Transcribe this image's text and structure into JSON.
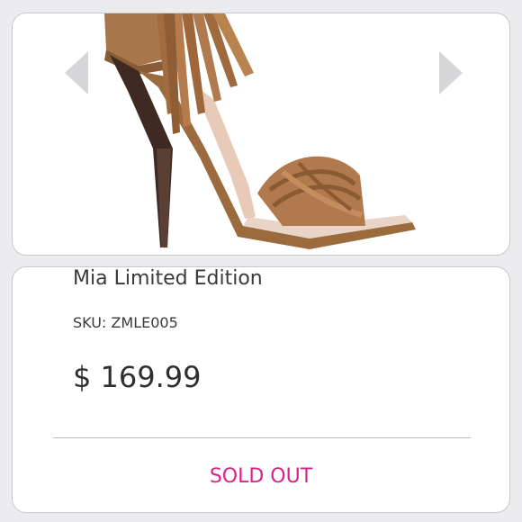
{
  "gallery": {
    "prev_icon": "chevron-left-icon",
    "next_icon": "chevron-right-icon"
  },
  "product": {
    "name": "Mia Limited Edition",
    "sku_label": "SKU:",
    "sku": "ZMLE005",
    "currency": "$",
    "price": "169.99",
    "status": "SOLD OUT"
  },
  "colors": {
    "status": "#d8238c",
    "arrow": "#d6d6d8",
    "leather": "#b07a4e",
    "heel": "#3e2a22"
  }
}
